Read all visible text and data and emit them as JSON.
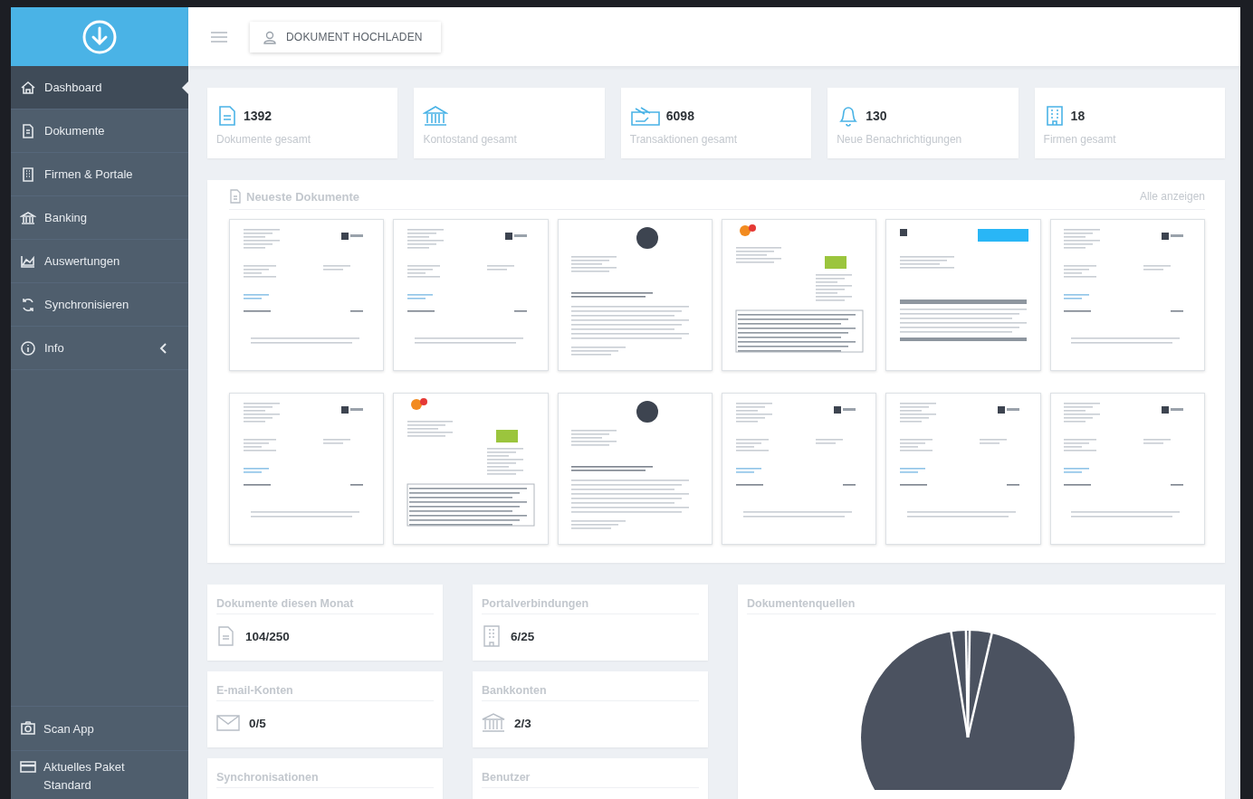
{
  "sidebar": {
    "items": [
      {
        "label": "Dashboard",
        "selected": true
      },
      {
        "label": "Dokumente",
        "selected": false
      },
      {
        "label": "Firmen & Portale",
        "selected": false
      },
      {
        "label": "Banking",
        "selected": false
      },
      {
        "label": "Auswertungen",
        "selected": false
      },
      {
        "label": "Synchronisieren",
        "selected": false
      },
      {
        "label": "Info",
        "selected": false,
        "expanded": false
      }
    ],
    "footer": [
      {
        "label": "Scan App"
      },
      {
        "label": "Aktuelles Paket",
        "sub": "Standard"
      }
    ]
  },
  "toolbar": {
    "upload_button": "DOKUMENT HOCHLADEN"
  },
  "stats": [
    {
      "value": "1392",
      "label": "Dokumente gesamt"
    },
    {
      "label": "Kontostand gesamt"
    },
    {
      "value": "6098",
      "label": "Transaktionen gesamt"
    },
    {
      "value": "130",
      "label": "Neue Benachrichtigungen"
    },
    {
      "value": "18",
      "label": "Firmen gesamt"
    }
  ],
  "recent_documents": {
    "title": "Neueste Dokumente",
    "link": "Alle anzeigen",
    "thumbnails": [
      {
        "kind": "invoice"
      },
      {
        "kind": "invoice"
      },
      {
        "kind": "letter"
      },
      {
        "kind": "statement"
      },
      {
        "kind": "form"
      },
      {
        "kind": "invoice"
      },
      {
        "kind": "invoice"
      },
      {
        "kind": "statement"
      },
      {
        "kind": "letter"
      },
      {
        "kind": "invoice"
      },
      {
        "kind": "invoice"
      },
      {
        "kind": "invoice"
      }
    ]
  },
  "usage_columns": [
    [
      {
        "title": "Dokumente diesen Monat",
        "value": "104/250"
      },
      {
        "title": "E-mail-Konten",
        "value": "0/5"
      },
      {
        "title": "Synchronisationen"
      }
    ],
    [
      {
        "title": "Portalverbindungen",
        "value": "6/25"
      },
      {
        "title": "Bankkonten",
        "value": "2/3"
      },
      {
        "title": "Benutzer"
      }
    ]
  ],
  "sources": {
    "title": "Dokumentenquellen"
  }
}
